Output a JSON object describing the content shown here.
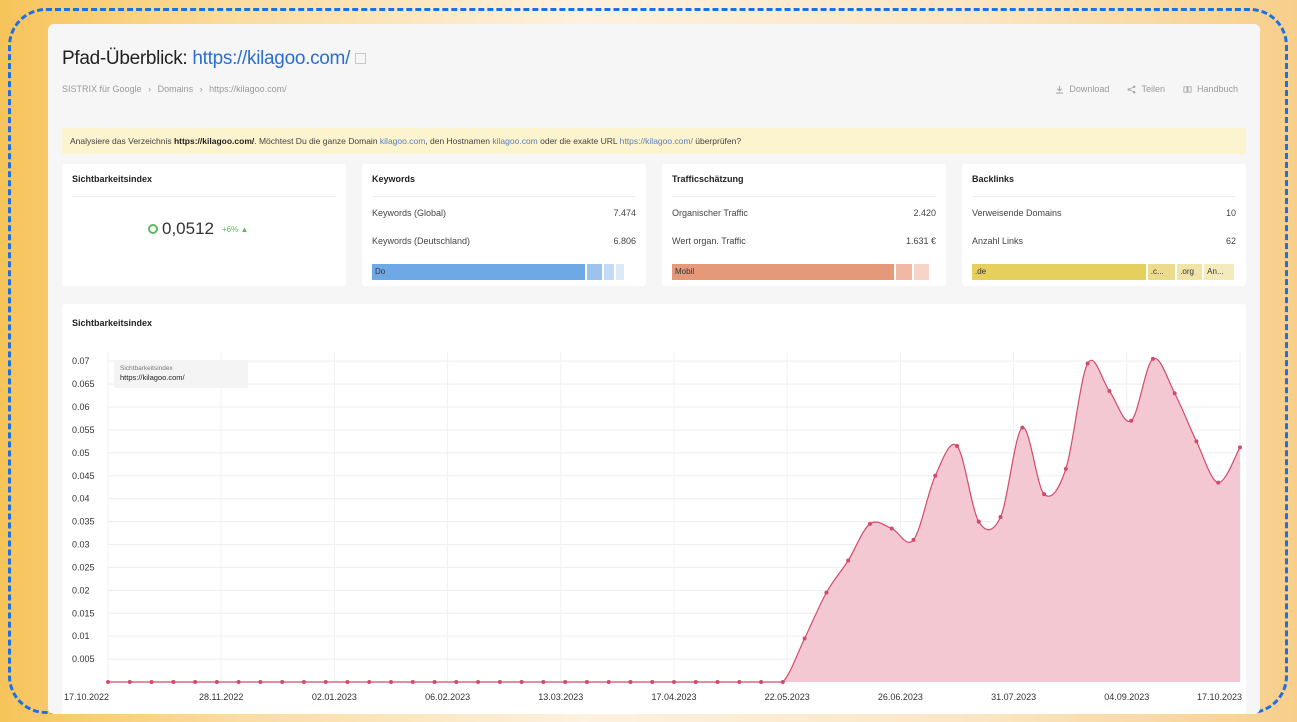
{
  "header": {
    "title_prefix": "Pfad-Überblick: ",
    "title_url": "https://kilagoo.com/"
  },
  "breadcrumb": [
    "SISTRIX für Google",
    "›",
    "Domains",
    "›",
    "https://kilagoo.com/"
  ],
  "toolbar": {
    "download": "Download",
    "share": "Teilen",
    "manual": "Handbuch"
  },
  "notice": {
    "t1": "Analysiere das Verzeichnis ",
    "b1": "https://kilagoo.com/",
    "t2": ". Möchtest Du die ganze Domain ",
    "l1": "kilagoo.com",
    "t3": ", den Hostnamen ",
    "l2": "kilagoo.com",
    "t4": " oder die exakte URL ",
    "l3": "https://kilagoo.com/",
    "t5": " überprüfen?"
  },
  "visibility_box": {
    "title": "Sichtbarkeitsindex",
    "value": "0,0512",
    "change": "+6% ▲"
  },
  "keywords_box": {
    "title": "Keywords",
    "rows": [
      {
        "label": "Keywords (Global)",
        "value": "7.474"
      },
      {
        "label": "Keywords (Deutschland)",
        "value": "6.806"
      }
    ],
    "bar": [
      {
        "label": "Do",
        "color": "#6fa8e6",
        "share": 0.86
      },
      {
        "label": "",
        "color": "#9cc3ee",
        "share": 0.05
      },
      {
        "label": "",
        "color": "#c3daf4",
        "share": 0.03
      },
      {
        "label": "",
        "color": "#dce9f8",
        "share": 0.02
      }
    ]
  },
  "traffic_box": {
    "title": "Trafficschätzung",
    "rows": [
      {
        "label": "Organischer Traffic",
        "value": "2.420"
      },
      {
        "label": "Wert organ. Traffic",
        "value": "1.631 €"
      }
    ],
    "bar": [
      {
        "label": "Mobil",
        "color": "#e5987a",
        "share": 0.88
      },
      {
        "label": "",
        "color": "#f0b9a3",
        "share": 0.05
      },
      {
        "label": "",
        "color": "#f6d5c8",
        "share": 0.05
      }
    ]
  },
  "backlinks_box": {
    "title": "Backlinks",
    "rows": [
      {
        "label": "Verweisende Domains",
        "value": "10"
      },
      {
        "label": "Anzahl Links",
        "value": "62"
      }
    ],
    "bar": [
      {
        "label": ".de",
        "color": "#e6cf5c",
        "share": 0.7
      },
      {
        "label": ".c...",
        "color": "#ecdb8c",
        "share": 0.1
      },
      {
        "label": ".org",
        "color": "#f1e4a8",
        "share": 0.09
      },
      {
        "label": "An...",
        "color": "#f4ebbd",
        "share": 0.11
      }
    ]
  },
  "chart_data": {
    "type": "area",
    "title": "Sichtbarkeitsindex",
    "legend": {
      "label": "Sichtbarkeitsindex",
      "series": "https://kilagoo.com/"
    },
    "xlabels": [
      "17.10.2022",
      "28.11.2022",
      "02.01.2023",
      "06.02.2023",
      "13.03.2023",
      "17.04.2023",
      "22.05.2023",
      "26.06.2023",
      "31.07.2023",
      "04.09.2023",
      "17.10.2023"
    ],
    "yticks": [
      "0.005",
      "0.01",
      "0.015",
      "0.02",
      "0.025",
      "0.03",
      "0.035",
      "0.04",
      "0.045",
      "0.05",
      "0.055",
      "0.06",
      "0.065",
      "0.07"
    ],
    "ylim": [
      0,
      0.072
    ],
    "grid": true,
    "color": "#d44a6a",
    "fill": "#f3c8d2",
    "points": [
      [
        "17.10.2022",
        0
      ],
      [
        "24.10.2022",
        0
      ],
      [
        "31.10.2022",
        0
      ],
      [
        "07.11.2022",
        0
      ],
      [
        "14.11.2022",
        0
      ],
      [
        "21.11.2022",
        0
      ],
      [
        "28.11.2022",
        0
      ],
      [
        "05.12.2022",
        0
      ],
      [
        "12.12.2022",
        0
      ],
      [
        "19.12.2022",
        0
      ],
      [
        "26.12.2022",
        0
      ],
      [
        "02.01.2023",
        0
      ],
      [
        "09.01.2023",
        0
      ],
      [
        "16.01.2023",
        0
      ],
      [
        "23.01.2023",
        0
      ],
      [
        "30.01.2023",
        0
      ],
      [
        "06.02.2023",
        0
      ],
      [
        "13.02.2023",
        0
      ],
      [
        "20.02.2023",
        0
      ],
      [
        "27.02.2023",
        0
      ],
      [
        "06.03.2023",
        0
      ],
      [
        "13.03.2023",
        0
      ],
      [
        "20.03.2023",
        0
      ],
      [
        "27.03.2023",
        0
      ],
      [
        "03.04.2023",
        0
      ],
      [
        "10.04.2023",
        0
      ],
      [
        "17.04.2023",
        0
      ],
      [
        "24.04.2023",
        0
      ],
      [
        "01.05.2023",
        0
      ],
      [
        "08.05.2023",
        0
      ],
      [
        "15.05.2023",
        0
      ],
      [
        "22.05.2023",
        0
      ],
      [
        "29.05.2023",
        0.0095
      ],
      [
        "05.06.2023",
        0.0195
      ],
      [
        "12.06.2023",
        0.0265
      ],
      [
        "19.06.2023",
        0.0345
      ],
      [
        "26.06.2023",
        0.0335
      ],
      [
        "03.07.2023",
        0.031
      ],
      [
        "10.07.2023",
        0.045
      ],
      [
        "17.07.2023",
        0.0515
      ],
      [
        "24.07.2023",
        0.035
      ],
      [
        "31.07.2023",
        0.036
      ],
      [
        "07.08.2023",
        0.0555
      ],
      [
        "14.08.2023",
        0.041
      ],
      [
        "21.08.2023",
        0.0465
      ],
      [
        "28.08.2023",
        0.0695
      ],
      [
        "04.09.2023",
        0.0635
      ],
      [
        "11.09.2023",
        0.057
      ],
      [
        "18.09.2023",
        0.0705
      ],
      [
        "25.09.2023",
        0.063
      ],
      [
        "02.10.2023",
        0.0525
      ],
      [
        "09.10.2023",
        0.0435
      ],
      [
        "17.10.2023",
        0.0512
      ]
    ]
  }
}
